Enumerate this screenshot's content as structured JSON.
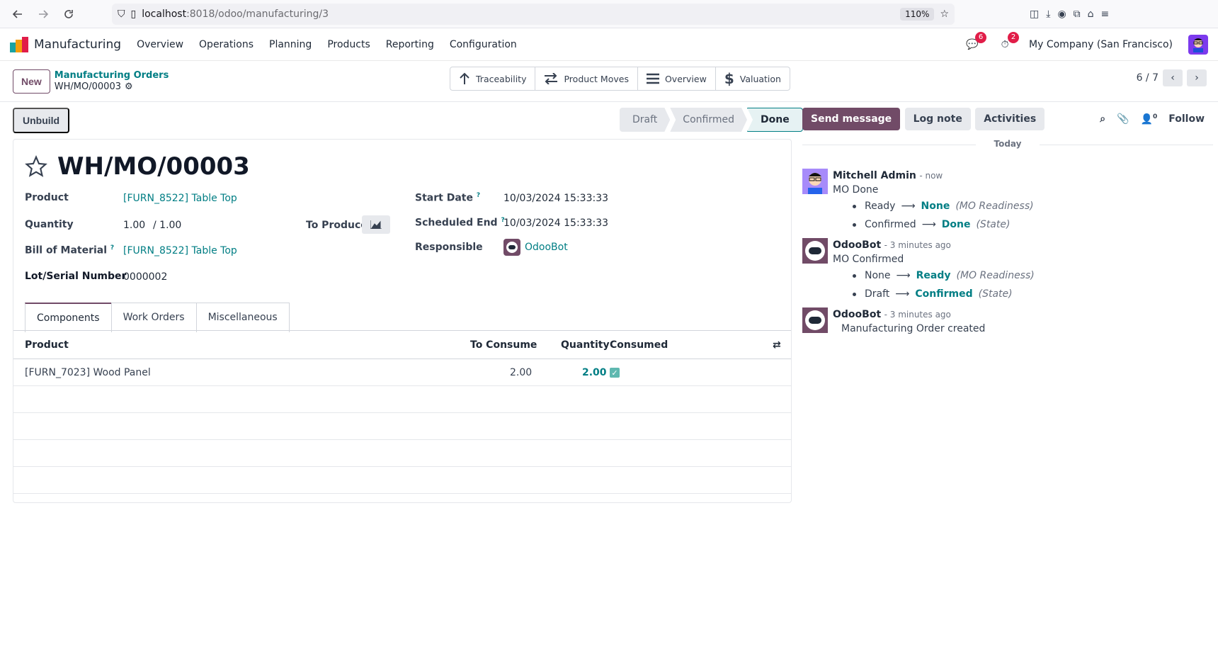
{
  "browser": {
    "host": "localhost",
    "path": ":8018/odoo/manufacturing/3",
    "zoom": "110%"
  },
  "app": {
    "name": "Manufacturing",
    "menu": [
      "Overview",
      "Operations",
      "Planning",
      "Products",
      "Reporting",
      "Configuration"
    ],
    "messages_count": "6",
    "activities_count": "2",
    "company": "My Company (San Francisco)"
  },
  "control": {
    "new_label": "New",
    "breadcrumb_parent": "Manufacturing Orders",
    "record_name": "WH/MO/00003",
    "pager": "6 / 7"
  },
  "smart_buttons": [
    "Traceability",
    "Product Moves",
    "Overview",
    "Valuation"
  ],
  "actions": {
    "unbuild": "Unbuild"
  },
  "stages": [
    "Draft",
    "Confirmed",
    "Done"
  ],
  "form": {
    "title": "WH/MO/00003",
    "product_label": "Product",
    "product_value": "[FURN_8522] Table Top",
    "quantity_label": "Quantity",
    "quantity_value": "1.00",
    "quantity_total": "/ 1.00",
    "to_produce_label": "To Produce",
    "bom_label": "Bill of Material",
    "bom_value": "[FURN_8522] Table Top",
    "lot_label": "Lot/Serial Number",
    "lot_value": "0000002",
    "start_label": "Start Date",
    "start_value": "10/03/2024 15:33:33",
    "end_label": "Scheduled End",
    "end_value": "10/03/2024 15:33:33",
    "resp_label": "Responsible",
    "resp_value": "OdooBot",
    "help_mark": "?"
  },
  "tabs": [
    "Components",
    "Work Orders",
    "Miscellaneous"
  ],
  "table": {
    "headers": {
      "product": "Product",
      "to_consume": "To Consume",
      "quantity": "Quantity",
      "consumed": "Consumed"
    },
    "rows": [
      {
        "product": "[FURN_7023] Wood Panel",
        "to_consume": "2.00",
        "quantity": "2.00",
        "consumed": true
      }
    ]
  },
  "chatter": {
    "send_message": "Send message",
    "log_note": "Log note",
    "activities": "Activities",
    "followers_count": "0",
    "follow": "Follow",
    "today": "Today",
    "messages": [
      {
        "author": "Mitchell Admin",
        "when": "- now",
        "text": "MO Done",
        "tracking": [
          {
            "old": "Ready",
            "new": "None",
            "field": "(MO Readiness)"
          },
          {
            "old": "Confirmed",
            "new": "Done",
            "field": "(State)"
          }
        ]
      },
      {
        "author": "OdooBot",
        "when": "- 3 minutes ago",
        "text": "MO Confirmed",
        "tracking": [
          {
            "old": "None",
            "new": "Ready",
            "field": "(MO Readiness)"
          },
          {
            "old": "Draft",
            "new": "Confirmed",
            "field": "(State)"
          }
        ]
      },
      {
        "author": "OdooBot",
        "when": "- 3 minutes ago",
        "text": "Manufacturing Order created",
        "tracking": []
      }
    ]
  },
  "colors": {
    "brand": "#714B67",
    "link": "#017e84"
  }
}
